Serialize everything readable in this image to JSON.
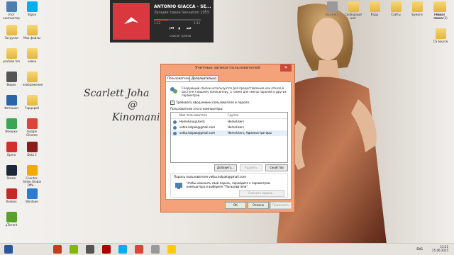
{
  "desktop_left": [
    {
      "label": "Этот компьютер",
      "color": "#4a7fb0"
    },
    {
      "label": "Skype",
      "color": "#00aff0"
    },
    {
      "label": "Загрузки",
      "color": "folder"
    },
    {
      "label": "Мои файлы",
      "color": "folder"
    },
    {
      "label": "youtube fon",
      "color": "folder"
    },
    {
      "label": "новое",
      "color": "folder"
    },
    {
      "label": "Видео",
      "color": "#555"
    },
    {
      "label": "изображения",
      "color": "folder"
    },
    {
      "label": "Фотошоп",
      "color": "#2b64a8"
    },
    {
      "label": "Гардероб",
      "color": "folder"
    },
    {
      "label": "Флешки",
      "color": "#3aa655"
    },
    {
      "label": "Google Chrome",
      "color": "#db4437"
    },
    {
      "label": "Opera",
      "color": "#d32f2f"
    },
    {
      "label": "Dota 2",
      "color": "#8b1d1d"
    },
    {
      "label": "Steam",
      "color": "#1b2838"
    },
    {
      "label": "Counter-Strike Global Offe...",
      "color": "#f2a900"
    },
    {
      "label": "Radeon",
      "color": "#c62828"
    },
    {
      "label": "Windows",
      "color": "#2b7bd3"
    },
    {
      "label": "µTorrent",
      "color": "#5aa02c"
    }
  ],
  "desktop_right": [
    {
      "label": "Корзина",
      "color": "#999"
    },
    {
      "label": "Свободный шаг",
      "color": "folder"
    },
    {
      "label": "Кадр",
      "color": "folder"
    },
    {
      "label": "Сайты",
      "color": "folder"
    },
    {
      "label": "Бумаги",
      "color": "folder"
    },
    {
      "label": "Новая папка",
      "color": "folder"
    },
    {
      "label": "Новая папка (2)",
      "color": "folder"
    },
    {
      "label": "CS Source",
      "color": "folder"
    }
  ],
  "player": {
    "artist": "ANTONIO GIACCA - SE...",
    "album": "Лучшие треки Sensation 2015",
    "time": "1:12",
    "duration": "3:33",
    "progress": 0.3,
    "tracklist_label": "список треков"
  },
  "signature": {
    "line1": "Scarlett Joha",
    "line2": "@",
    "line3": "Kinomania"
  },
  "dialog": {
    "title": "Учетные записи пользователей",
    "close": "✕",
    "tab_users": "Пользователи",
    "tab_advanced": "Дополнительно",
    "description": "Следующий список используется для предоставления или отказа в доступе к вашему компьютеру, а также для смены паролей и других параметров.",
    "checkbox_label": "Требовать ввод имени пользователя и пароля.",
    "checkbox_checked": true,
    "users_header": "Пользователи этого компьютера:",
    "col_name": "Имя пользователя",
    "col_group": "Группа",
    "rows": [
      {
        "name": "HomeGroupUser$",
        "group": "HomeUsers",
        "selected": false
      },
      {
        "name": "vetka.kolpak@gmail.com",
        "group": "HomeUsers",
        "selected": false
      },
      {
        "name": "vetka.kolpak@gmail.com",
        "group": "HomeUsers; Администраторы",
        "selected": true
      }
    ],
    "btn_add": "Добавить...",
    "btn_remove": "Удалить",
    "btn_properties": "Свойства",
    "password_header": "Пароль пользователя vetka.kolpak@gmail.com",
    "password_text": "Чтобы изменить свой пароль, перейдите к параметрам компьютера и выберите \"Пользователи\".",
    "btn_change_password": "Сменить пароль...",
    "btn_ok": "ОК",
    "btn_cancel": "Отмена",
    "btn_apply": "Применить"
  },
  "taskbar": {
    "apps": [
      "#2b579a",
      "#e6e3df",
      "#e6e3df",
      "#c43e1c",
      "#7fba00",
      "#555",
      "#a00",
      "#00aff0",
      "#db4437",
      "#999",
      "#ffcc00"
    ],
    "time": "13:21",
    "date": "25.06.2015",
    "lang": "ENG"
  }
}
